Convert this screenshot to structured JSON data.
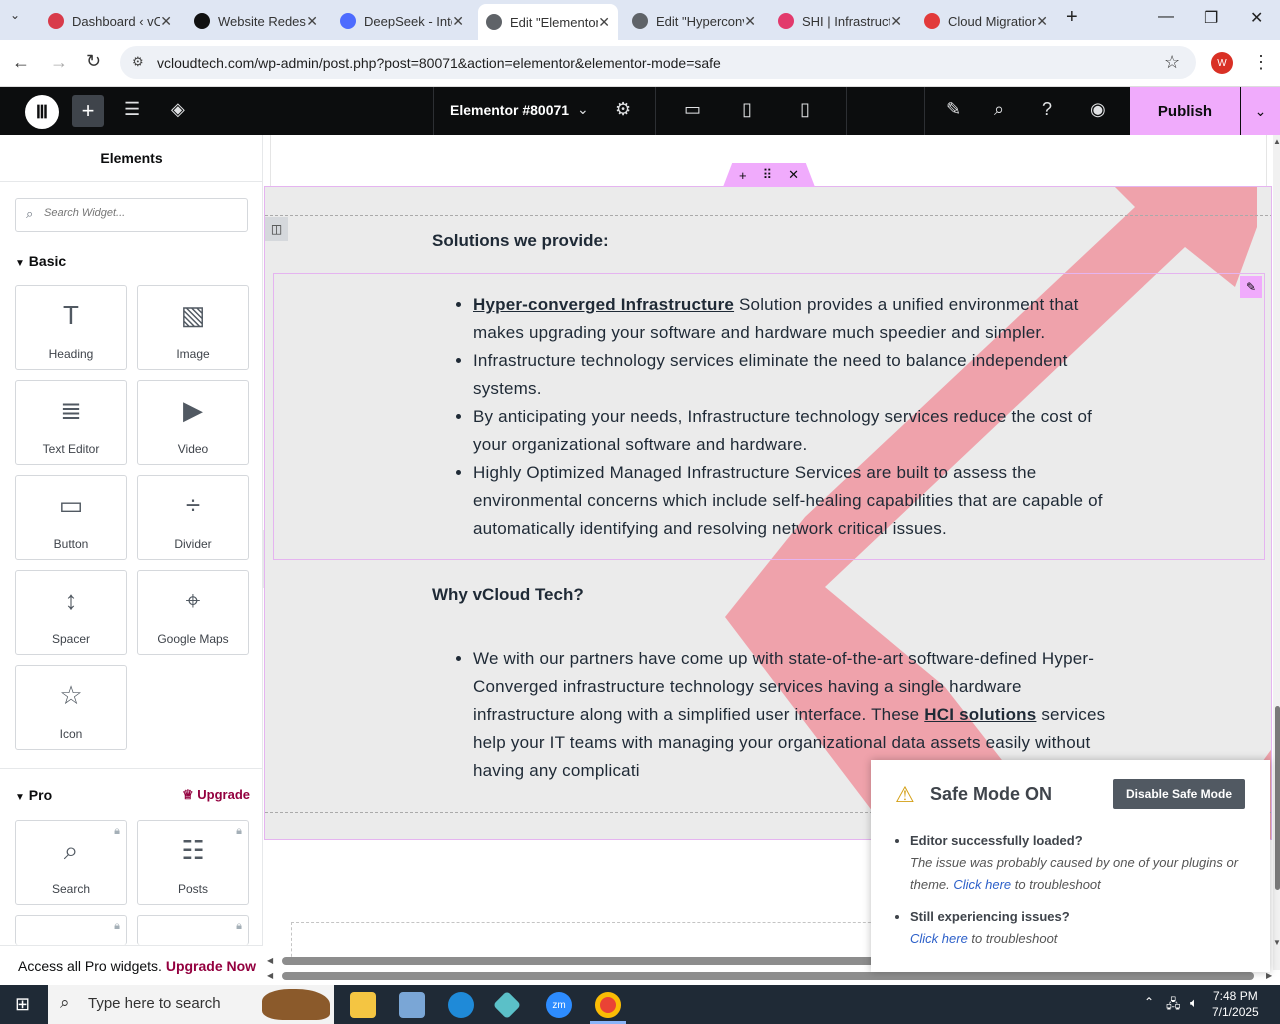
{
  "browser": {
    "tabs": [
      {
        "title": "Dashboard ‹ vCloud",
        "color": "#d83b4a"
      },
      {
        "title": "Website Redesign",
        "color": "#111111"
      },
      {
        "title": "DeepSeek - Into",
        "color": "#4d6bfe"
      },
      {
        "title": "Edit \"Elementor",
        "color": "#5f6368"
      },
      {
        "title": "Edit \"Hyperconv",
        "color": "#5f6368"
      },
      {
        "title": "SHI | Infrastructu",
        "color": "#e23a6c"
      },
      {
        "title": "Cloud Migration",
        "color": "#e23a3a"
      }
    ],
    "url": "vcloudtech.com/wp-admin/post.php?post=80071&action=elementor&elementor-mode=safe",
    "profile_letter": "W"
  },
  "editor": {
    "document_title": "Elementor #80071",
    "publish_label": "Publish"
  },
  "panel": {
    "title": "Elements",
    "search_placeholder": "Search Widget...",
    "basic_label": "Basic",
    "basic_widgets": [
      {
        "label": "Heading",
        "icon": "T"
      },
      {
        "label": "Image",
        "icon": "▧"
      },
      {
        "label": "Text Editor",
        "icon": "≣"
      },
      {
        "label": "Video",
        "icon": "▶"
      },
      {
        "label": "Button",
        "icon": "▭"
      },
      {
        "label": "Divider",
        "icon": "÷"
      },
      {
        "label": "Spacer",
        "icon": "↕"
      },
      {
        "label": "Google Maps",
        "icon": "⌖"
      },
      {
        "label": "Icon",
        "icon": "☆"
      }
    ],
    "pro_label": "Pro",
    "upgrade_label": "Upgrade",
    "pro_widgets": [
      {
        "label": "Search",
        "icon": "⌕"
      },
      {
        "label": "Posts",
        "icon": "☷"
      }
    ],
    "pro_bar_text": "Access all Pro widgets.",
    "pro_bar_link": "Upgrade Now"
  },
  "content": {
    "heading1": "Solutions we provide:",
    "list1_link": "Hyper-converged Infrastructure",
    "list1_item1_rest": " Solution provides a unified environment that makes upgrading your software and hardware much speedier and simpler.",
    "list1_item2": "Infrastructure technology services eliminate the need to balance independent systems.",
    "list1_item3": "By anticipating your needs, Infrastructure technology services reduce the cost of your organizational software and hardware.",
    "list1_item4": "Highly Optimized Managed Infrastructure Services are built to assess the environmental concerns which include self-healing capabilities that are capable of automatically identifying and resolving network critical issues.",
    "heading2": "Why vCloud Tech?",
    "list2_before": "We with our partners have come up with state-of-the-art software-defined Hyper-Converged infrastructure technology services having a single hardware infrastructure along with a simplified user interface. These ",
    "list2_link": "HCI solutions",
    "list2_after": " services help your IT teams with managing your organizational data assets easily without having any complicati"
  },
  "safe_mode": {
    "title": "Safe Mode ON",
    "button": "Disable Safe Mode",
    "q1": "Editor successfully loaded?",
    "a1_before": "The issue was probably caused by one of your plugins or theme. ",
    "a1_link": "Click here",
    "a1_after": " to troubleshoot",
    "q2": "Still experiencing issues?",
    "a2_link": "Click here",
    "a2_after": " to troubleshoot"
  },
  "taskbar": {
    "search_placeholder": "Type here to search",
    "time": "7:48 PM",
    "date": "7/1/2025"
  },
  "colors": {
    "accent": "#f0abfc",
    "editor_bar": "#0c0d0e",
    "stripe": "#f08a96"
  }
}
